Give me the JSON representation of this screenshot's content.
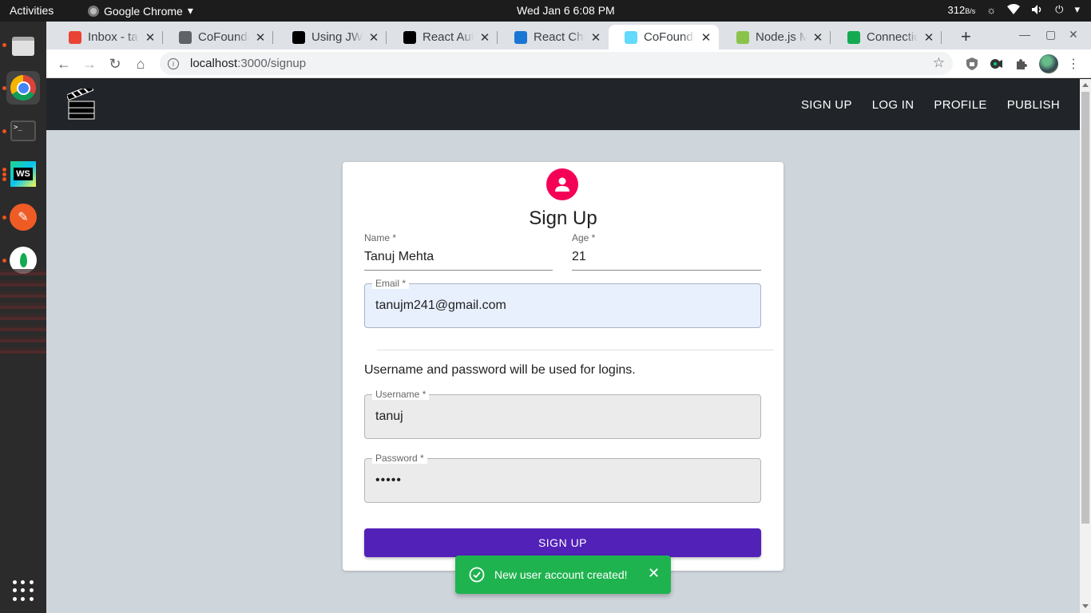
{
  "system": {
    "activities": "Activities",
    "app_name": "Google Chrome",
    "clock": "Wed Jan 6   6:08 PM",
    "net_value": "312",
    "net_unit": "B/s"
  },
  "browser": {
    "tabs": [
      {
        "title": "Inbox - tanuj",
        "favicon_color": "#ea4335",
        "active": false
      },
      {
        "title": "CoFounder",
        "favicon_color": "#5f6368",
        "active": false
      },
      {
        "title": "Using JWT",
        "favicon_color": "#000000",
        "active": false
      },
      {
        "title": "React Auth",
        "favicon_color": "#000000",
        "active": false
      },
      {
        "title": "React Chip",
        "favicon_color": "#1976d2",
        "active": false
      },
      {
        "title": "CoFounder",
        "favicon_color": "#61dafb",
        "active": true
      },
      {
        "title": "Node.js Mo",
        "favicon_color": "#8bc34a",
        "active": false
      },
      {
        "title": "Connection",
        "favicon_color": "#13aa52",
        "active": false
      }
    ],
    "close_glyph": "✕",
    "new_tab_glyph": "+",
    "url_host": "localhost",
    "url_path": ":3000/signup"
  },
  "app": {
    "nav": [
      "SIGN UP",
      "LOG IN",
      "PROFILE",
      "PUBLISH"
    ]
  },
  "form": {
    "title": "Sign Up",
    "name_label": "Name *",
    "name_value": "Tanuj Mehta",
    "age_label": "Age *",
    "age_value": "21",
    "email_label": "Email *",
    "email_value": "tanujm241@gmail.com",
    "note": "Username and password will be used for logins.",
    "username_label": "Username *",
    "username_value": "tanuj",
    "password_label": "Password *",
    "password_value": "•••••",
    "submit_label": "SIGN UP"
  },
  "toast": {
    "message": "New user account created!",
    "color": "#1fb34f"
  },
  "colors": {
    "button": "#5221b8",
    "avatar": "#f50057",
    "appbar": "#212529"
  }
}
